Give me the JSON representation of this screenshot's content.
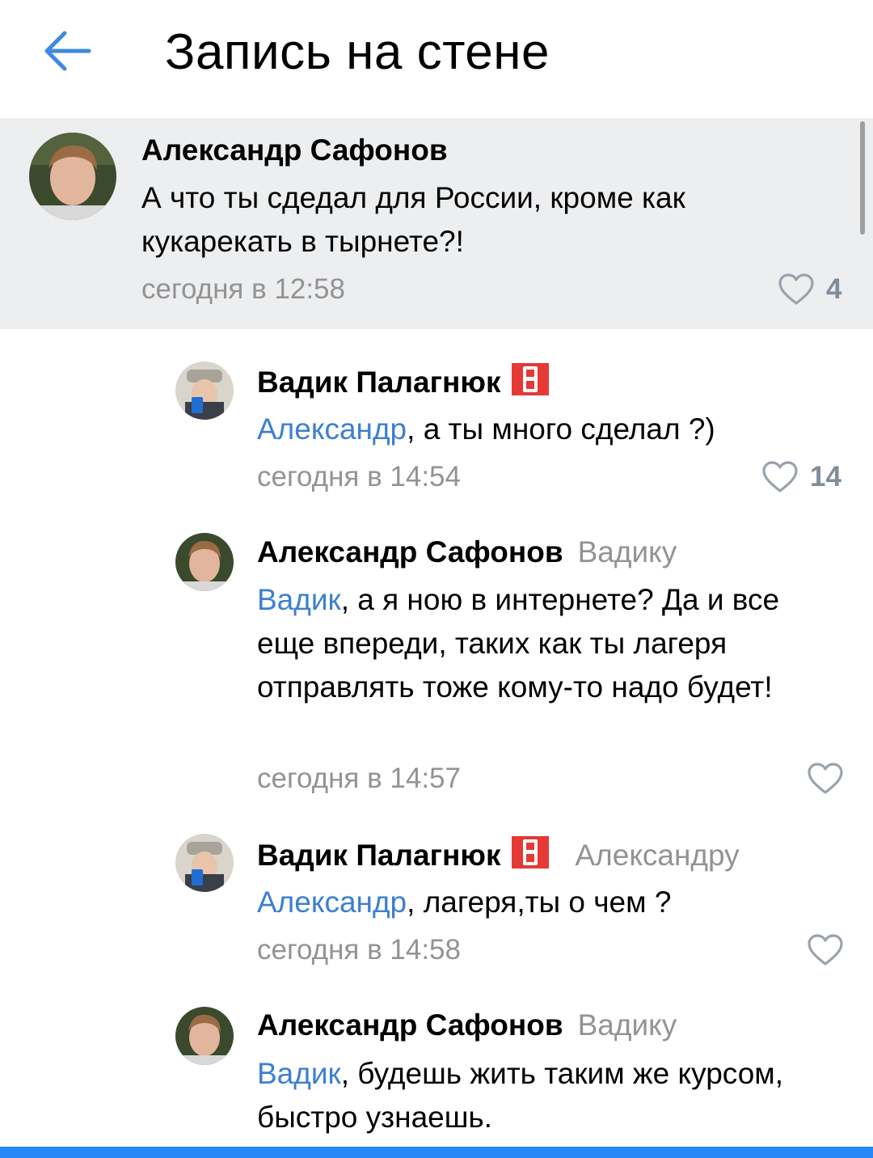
{
  "header": {
    "title": "Запись на стене",
    "back_icon": "arrow-left-icon",
    "accent": "#3f8ae0"
  },
  "comments": [
    {
      "author": "Александр Сафонов",
      "reply_to": "",
      "mention": "",
      "text": "А что ты сдедал для России, кроме как кукарекать в тырнете?!",
      "time": "сегодня в 12:58",
      "likes": "4"
    },
    {
      "author": "Вадик Палагнюк",
      "badge": "8",
      "reply_to": "",
      "mention": "Александр",
      "text": ", а ты много сделал ?)",
      "time": "сегодня в 14:54",
      "likes": "14"
    },
    {
      "author": "Александр Сафонов",
      "reply_to": "Вадику",
      "mention": "Вадик",
      "text": ", а я ною в интернете? Да и все еще впереди, таких как ты лагеря отправлять тоже кому-то надо будет!",
      "time": "сегодня в 14:57",
      "likes": ""
    },
    {
      "author": "Вадик Палагнюк",
      "badge": "8",
      "reply_to": "Александру",
      "mention": "Александр",
      "text": ", лагеря,ты о чем ?",
      "time": "сегодня в 14:58",
      "likes": ""
    },
    {
      "author": "Александр Сафонов",
      "reply_to": "Вадику",
      "mention": "Вадик",
      "text": ", будешь жить таким же курсом, быстро узнаешь.",
      "time": "",
      "likes": ""
    }
  ],
  "colors": {
    "highlight_bg": "#edeef0",
    "mention": "#3d7fd0",
    "secondary_text": "#939393",
    "bottom_bar": "#2787f5"
  }
}
